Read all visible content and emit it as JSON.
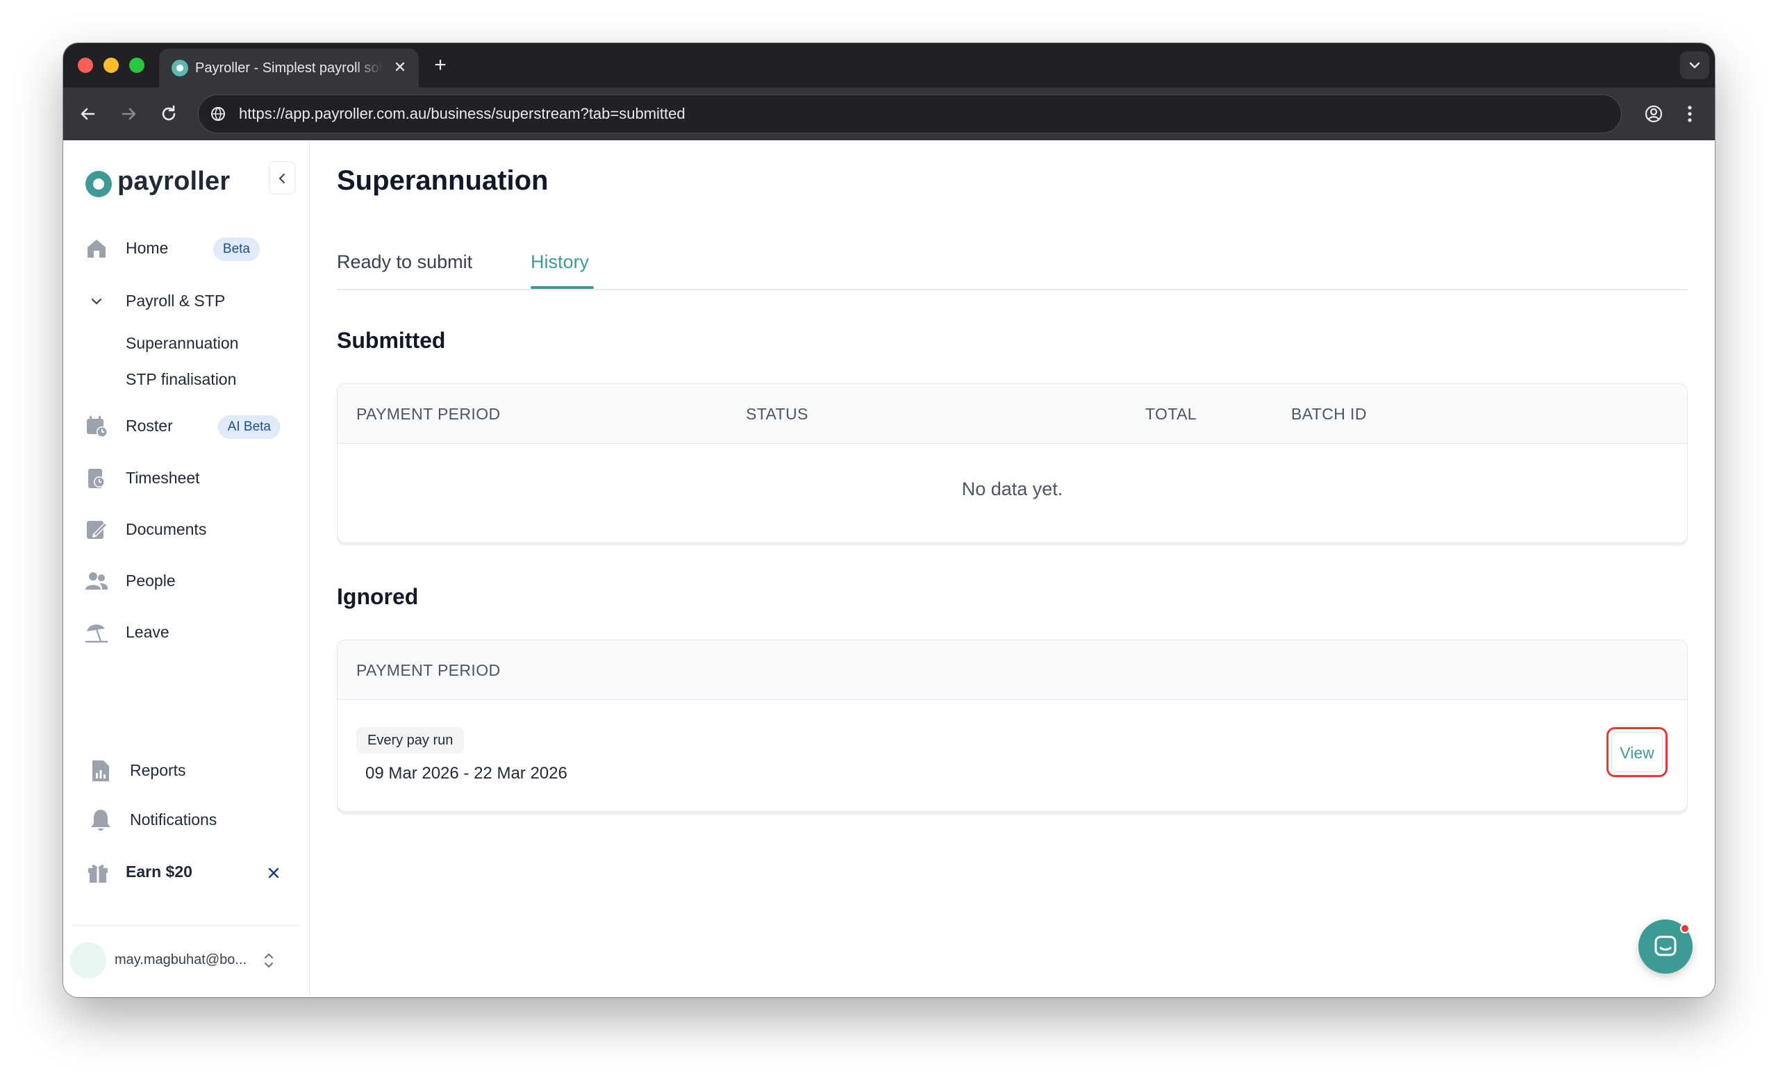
{
  "browser": {
    "tab_title": "Payroller - Simplest payroll software",
    "url": "https://app.payroller.com.au/business/superstream?tab=submitted"
  },
  "sidebar": {
    "logo_text": "payroller",
    "items": {
      "home": {
        "label": "Home",
        "badge": "Beta"
      },
      "payroll": {
        "label": "Payroll & STP"
      },
      "superannuation": {
        "label": "Superannuation"
      },
      "stp_finalisation": {
        "label": "STP finalisation"
      },
      "roster": {
        "label": "Roster",
        "badge": "AI Beta"
      },
      "timesheet": {
        "label": "Timesheet"
      },
      "documents": {
        "label": "Documents"
      },
      "people": {
        "label": "People"
      },
      "leave": {
        "label": "Leave"
      },
      "reports": {
        "label": "Reports"
      },
      "notifications": {
        "label": "Notifications"
      },
      "earn": {
        "label": "Earn $20"
      }
    },
    "user_email": "may.magbuhat@bo..."
  },
  "main": {
    "title": "Superannuation",
    "tabs": [
      "Ready to submit",
      "History"
    ],
    "active_tab": "History",
    "submitted": {
      "title": "Submitted",
      "columns": [
        "PAYMENT PERIOD",
        "STATUS",
        "TOTAL",
        "BATCH ID"
      ],
      "empty_text": "No data yet."
    },
    "ignored": {
      "title": "Ignored",
      "columns": [
        "PAYMENT PERIOD"
      ],
      "rows": [
        {
          "frequency": "Every pay run",
          "period": "09 Mar 2026 - 22 Mar 2026",
          "action": "View"
        }
      ]
    }
  },
  "colors": {
    "accent": "#3d9a94",
    "highlight": "#e53935",
    "badge_bg": "#e0ebf7",
    "badge_text": "#1e4f8c"
  }
}
